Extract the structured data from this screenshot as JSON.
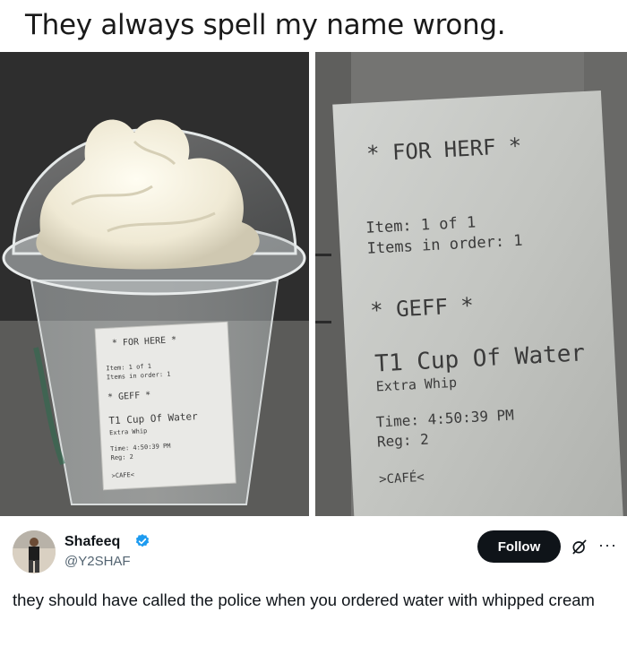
{
  "meme": {
    "caption": "They always spell my name wrong."
  },
  "receipt_left": {
    "header": "* FOR HERE *",
    "item_line": "Item:   1 of 1",
    "items_line": "Items in order: 1",
    "name_line": "* GEFF *",
    "product": "T1 Cup Of Water",
    "modifier": "Extra Whip",
    "time_line": "Time:  4:50:39 PM",
    "reg_line": "Reg:   2",
    "footer": ">CAFE<"
  },
  "receipt_right": {
    "header": "* FOR HERF *",
    "item_line": "Item:   1 of 1",
    "items_line": "Items in order: 1",
    "name_line": "* GEFF *",
    "product": "T1 Cup Of Water",
    "modifier": "Extra Whip",
    "time_line": "Time:  4:50:39 PM",
    "reg_line": "Reg:   2",
    "footer": ">CAFÉ<"
  },
  "tweet": {
    "display_name": "Shafeeq",
    "handle": "@Y2SHAF",
    "follow_label": "Follow",
    "text": "they should have called the police when you ordered water with whipped cream",
    "verified_color": "#1d9bf0"
  }
}
